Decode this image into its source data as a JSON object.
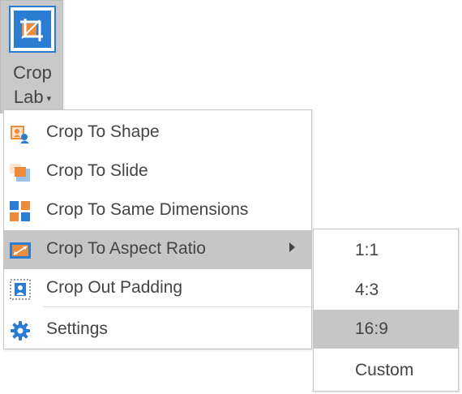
{
  "ribbon": {
    "crop_lab": {
      "label_line1": "Crop",
      "label_line2": "Lab",
      "dropdown_caret": "▾",
      "icon": "crop-lab-icon"
    }
  },
  "menu": {
    "items": [
      {
        "label": "Crop To Shape",
        "icon": "crop-to-shape-icon"
      },
      {
        "label": "Crop To Slide",
        "icon": "crop-to-slide-icon"
      },
      {
        "label": "Crop To Same Dimensions",
        "icon": "crop-same-dimensions-icon"
      },
      {
        "label": "Crop To Aspect Ratio",
        "icon": "crop-aspect-ratio-icon",
        "highlighted": true,
        "has_submenu": true
      },
      {
        "label": "Crop Out Padding",
        "icon": "crop-out-padding-icon"
      },
      {
        "label": "Settings",
        "icon": "gear-icon"
      }
    ]
  },
  "submenu": {
    "items": [
      {
        "label": "1:1"
      },
      {
        "label": "4:3"
      },
      {
        "label": "16:9",
        "highlighted": true
      },
      {
        "label": "Custom"
      }
    ]
  },
  "colors": {
    "blue": "#2b7cd3",
    "orange": "#ed8b3d",
    "highlight": "#c6c6c6"
  }
}
